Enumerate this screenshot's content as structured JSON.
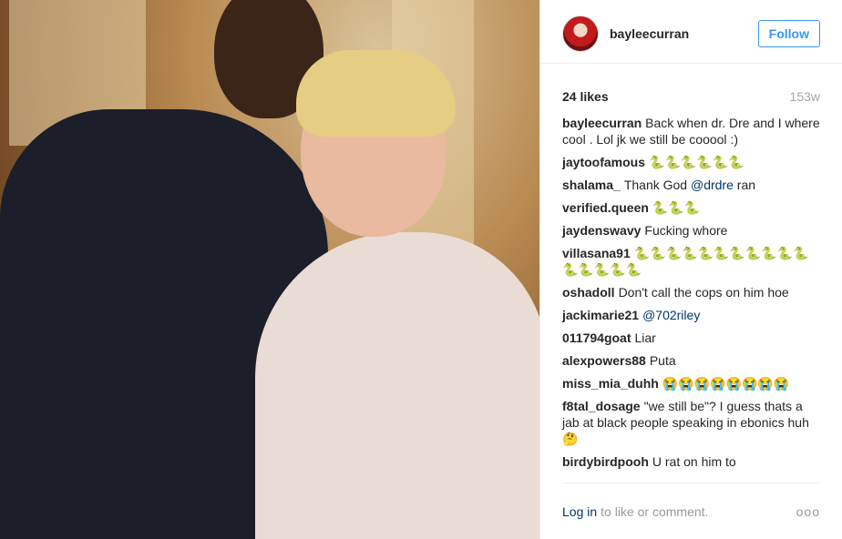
{
  "header": {
    "username": "bayleecurran",
    "follow_label": "Follow"
  },
  "meta": {
    "likes": "24 likes",
    "time": "153w"
  },
  "comments": [
    {
      "user": "bayleecurran",
      "text": "Back when dr. Dre and I where cool . Lol jk we still be cooool :)"
    },
    {
      "user": "jaytoofamous",
      "text": "🐍🐍🐍🐍🐍🐍"
    },
    {
      "user": "shalama_",
      "text": "Thank God",
      "mention": "@drdre",
      "after": "ran"
    },
    {
      "user": "verified.queen",
      "text": "🐍🐍🐍"
    },
    {
      "user": "jaydenswavy",
      "text": "Fucking whore"
    },
    {
      "user": "villasana91",
      "text": "🐍🐍🐍🐍🐍🐍🐍🐍🐍🐍🐍🐍🐍🐍🐍🐍"
    },
    {
      "user": "oshadoll",
      "text": "Don't call the cops on him hoe"
    },
    {
      "user": "jackimarie21",
      "text": "",
      "mention": "@702riley",
      "after": ""
    },
    {
      "user": "011794goat",
      "text": "Liar"
    },
    {
      "user": "alexpowers88",
      "text": "Puta"
    },
    {
      "user": "miss_mia_duhh",
      "text": "😭😭😭😭😭😭😭😭"
    },
    {
      "user": "f8tal_dosage",
      "text": "\"we still be\"? I guess thats a jab at black people speaking in ebonics huh 🤔"
    },
    {
      "user": "birdybirdpooh",
      "text": "U rat on him to"
    }
  ],
  "footer": {
    "login": "Log in",
    "rest": "to like or comment.",
    "more": "ooo"
  }
}
